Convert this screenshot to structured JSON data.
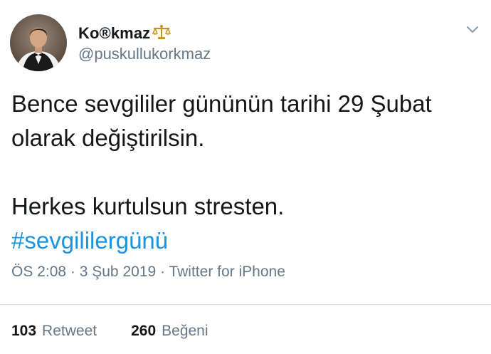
{
  "author": {
    "name_prefix": "Ko",
    "name_mark": "®",
    "name_suffix": "kmaz",
    "handle": "@puskullukorkmaz",
    "avatar_icon": "profile-photo",
    "badge_icon": "scale-icon"
  },
  "tweet": {
    "lines": [
      "Bence sevgililer gününün tarihi 29 Şubat",
      "olarak değiştirilsin."
    ],
    "line3": "Herkes kurtulsun stresten.",
    "hashtag": "#sevgililergünü"
  },
  "meta": {
    "time": "ÖS 2:08",
    "separator1": " · ",
    "date": "3 Şub 2019",
    "separator2": " · ",
    "client": "Twitter for iPhone"
  },
  "stats": {
    "retweet_count": "103",
    "retweet_label": "Retweet",
    "like_count": "260",
    "like_label": "Beğeni"
  },
  "menu": {
    "icon": "chevron-down-icon"
  },
  "colors": {
    "text": "#14171a",
    "secondary": "#657786",
    "link": "#1b95e0",
    "divider": "#e1e8ed"
  }
}
